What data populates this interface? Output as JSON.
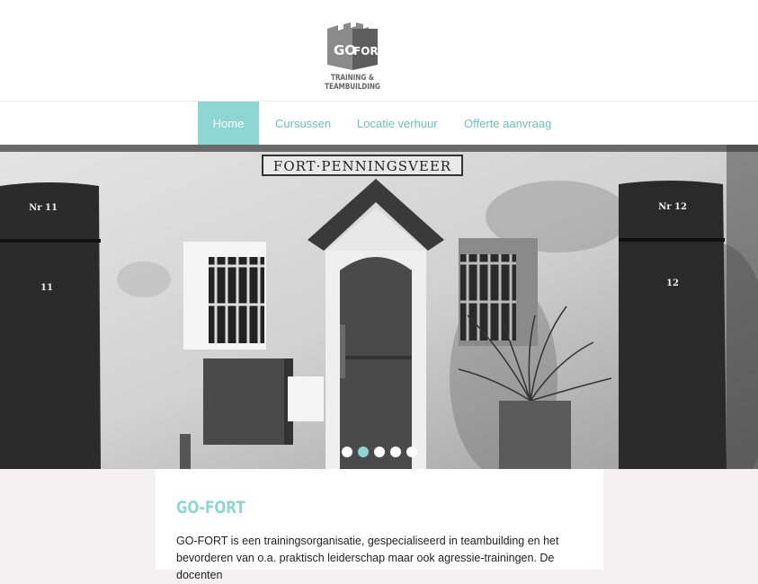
{
  "brand": {
    "logo_text_left": "GO",
    "logo_text_right": "FORT",
    "tagline": "TRAINING & TEAMBUILDING"
  },
  "nav": {
    "items": [
      {
        "label": "Home",
        "active": true
      },
      {
        "label": "Cursussen",
        "active": false
      },
      {
        "label": "Locatie verhuur",
        "active": false
      },
      {
        "label": "Offerte aanvraag",
        "active": false
      }
    ]
  },
  "hero": {
    "sign_text": "FORT·PENNINGSVEER",
    "door_left_label": "Nr 11",
    "door_left_number": "11",
    "door_right_label": "Nr 12",
    "door_right_number": "12",
    "slides_total": 5,
    "active_slide": 2
  },
  "intro": {
    "title": "GO-FORT",
    "text": "GO-FORT is een trainingsorganisatie, gespecialiseerd in teambuilding en het bevorderen van o.a. praktisch leiderschap maar ook agressie-trainingen. De docenten"
  },
  "colors": {
    "accent": "#8dd6d4",
    "nav_text": "#6cbfc0",
    "page_bg": "#f3f1f1"
  }
}
